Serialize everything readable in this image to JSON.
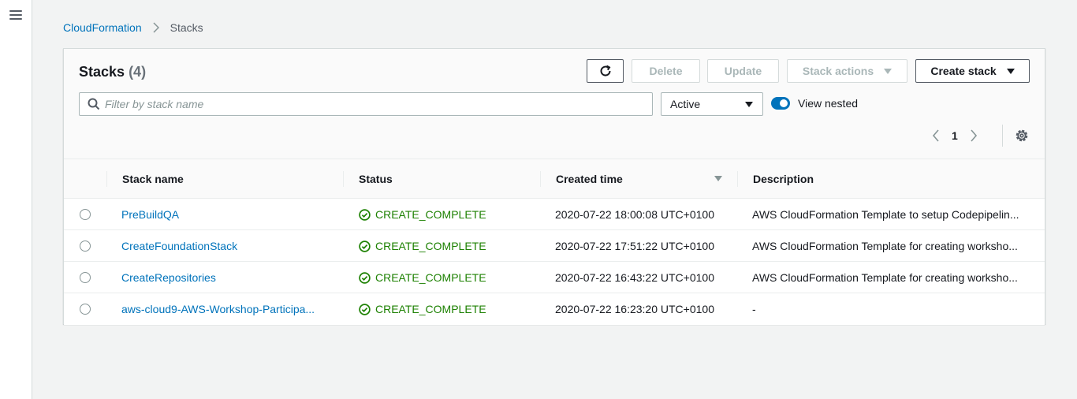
{
  "nav": {
    "menu_icon": "hamburger-menu-icon"
  },
  "breadcrumb": {
    "root": "CloudFormation",
    "current": "Stacks"
  },
  "panel": {
    "title": "Stacks",
    "count": "(4)",
    "buttons": {
      "refresh_icon": "refresh-icon",
      "delete": "Delete",
      "update": "Update",
      "stack_actions": "Stack actions",
      "create_stack": "Create stack"
    },
    "search": {
      "placeholder": "Filter by stack name",
      "value": ""
    },
    "filter_select": {
      "value": "Active"
    },
    "view_nested": {
      "label": "View nested",
      "enabled": true
    },
    "pagination": {
      "page": "1"
    }
  },
  "table": {
    "headers": {
      "name": "Stack name",
      "status": "Status",
      "created": "Created time",
      "description": "Description"
    },
    "rows": [
      {
        "name": "PreBuildQA",
        "status": "CREATE_COMPLETE",
        "created": "2020-07-22 18:00:08 UTC+0100",
        "description": "AWS CloudFormation Template to setup Codepipelin..."
      },
      {
        "name": "CreateFoundationStack",
        "status": "CREATE_COMPLETE",
        "created": "2020-07-22 17:51:22 UTC+0100",
        "description": "AWS CloudFormation Template for creating worksho..."
      },
      {
        "name": "CreateRepositories",
        "status": "CREATE_COMPLETE",
        "created": "2020-07-22 16:43:22 UTC+0100",
        "description": "AWS CloudFormation Template for creating worksho..."
      },
      {
        "name": "aws-cloud9-AWS-Workshop-Participa...",
        "status": "CREATE_COMPLETE",
        "created": "2020-07-22 16:23:20 UTC+0100",
        "description": "-"
      }
    ]
  },
  "colors": {
    "link": "#0073bb",
    "success": "#1d8102",
    "toggle": "#0073bb"
  }
}
